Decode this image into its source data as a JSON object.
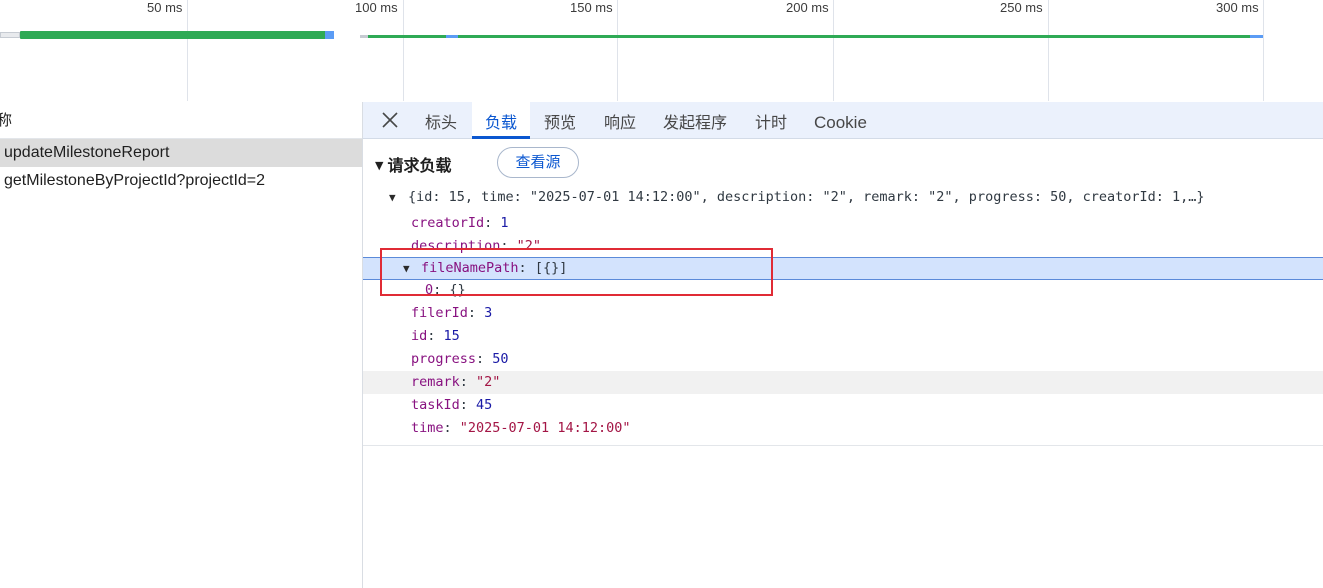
{
  "timeline": {
    "ticks": [
      "50 ms",
      "100 ms",
      "150 ms",
      "200 ms",
      "250 ms",
      "300 ms"
    ]
  },
  "requests": {
    "column_header": "称",
    "items": [
      {
        "name": "updateMilestoneReport",
        "selected": true
      },
      {
        "name": "getMilestoneByProjectId?projectId=2",
        "selected": false
      }
    ]
  },
  "details": {
    "tabs": [
      "标头",
      "负载",
      "预览",
      "响应",
      "发起程序",
      "计时",
      "Cookie"
    ],
    "active_tab": "负载",
    "section_title": "请求负载",
    "view_source_label": "查看源",
    "summary": "{id: 15, time: \"2025-07-01 14:12:00\", description: \"2\", remark: \"2\", progress: 50, creatorId: 1,…}",
    "fields": {
      "creatorId": {
        "key": "creatorId",
        "value": "1"
      },
      "description": {
        "key": "description",
        "value": "\"2\""
      },
      "fileNamePath": {
        "key": "fileNamePath",
        "value": "[{}]"
      },
      "fileNamePath_0": {
        "key": "0",
        "value": "{}"
      },
      "filerId": {
        "key": "filerId",
        "value": "3"
      },
      "id": {
        "key": "id",
        "value": "15"
      },
      "progress": {
        "key": "progress",
        "value": "50"
      },
      "remark": {
        "key": "remark",
        "value": "\"2\""
      },
      "taskId": {
        "key": "taskId",
        "value": "45"
      },
      "time": {
        "key": "time",
        "value": "\"2025-07-01 14:12:00\""
      }
    }
  },
  "colors": {
    "accent": "#0b57d0",
    "timeline_green": "#34a853",
    "timeline_blue": "#5b9cf5",
    "annotation_red": "#e02b35",
    "selection_bg": "#d3e3fd"
  },
  "icons": {
    "close": "close-icon",
    "expand": "triangle-down-icon"
  }
}
